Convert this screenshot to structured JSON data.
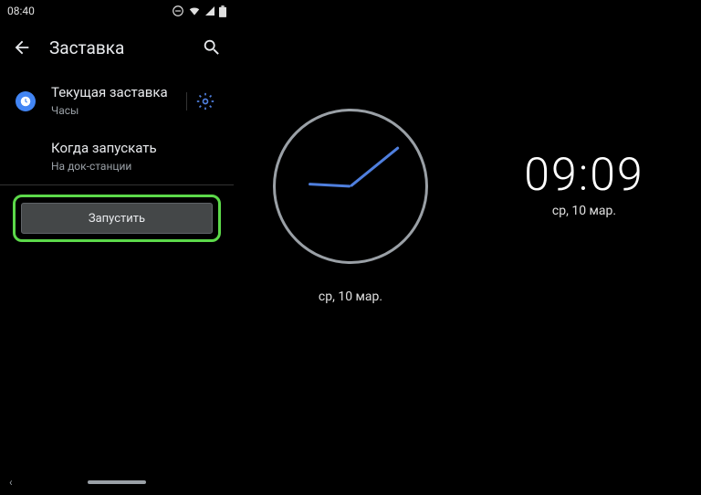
{
  "status": {
    "time": "08:40"
  },
  "appbar": {
    "title": "Заставка"
  },
  "rows": {
    "current": {
      "title": "Текущая заставка",
      "sub": "Часы"
    },
    "when": {
      "title": "Когда запускать",
      "sub": "На док-станции"
    }
  },
  "start_button": "Запустить",
  "analog": {
    "date": "ср, 10 мар."
  },
  "digital": {
    "time": "09:09",
    "date": "ср, 10 мар."
  }
}
